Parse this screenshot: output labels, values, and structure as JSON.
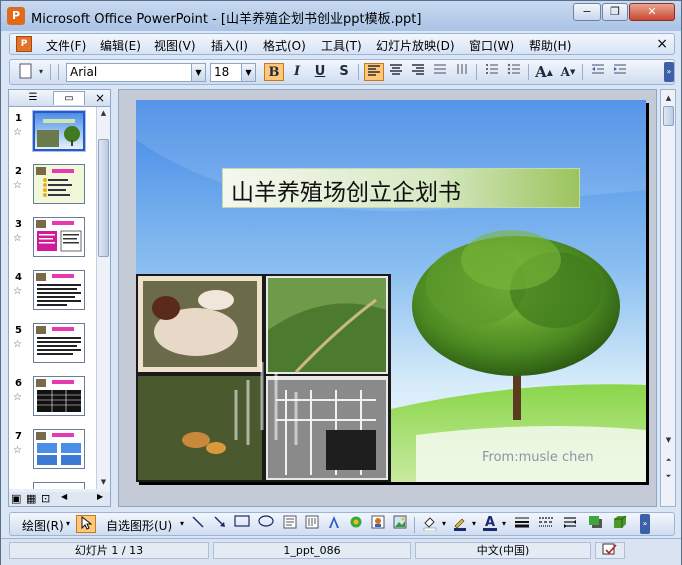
{
  "window": {
    "title": "Microsoft Office PowerPoint - [山羊养殖企划书创业ppt模板.ppt]",
    "app_icon": "powerpoint-icon",
    "minimize_label": "−",
    "restore_label": "❐",
    "close_label": "✕"
  },
  "menubar": {
    "items": [
      "文件(F)",
      "编辑(E)",
      "视图(V)",
      "插入(I)",
      "格式(O)",
      "工具(T)",
      "幻灯片放映(D)",
      "窗口(W)",
      "帮助(H)"
    ],
    "close_label": "×"
  },
  "toolbar": {
    "font_name": "Arial",
    "font_size": "18",
    "bold_label": "B",
    "italic_label": "I",
    "underline_label": "U",
    "shadow_label": "S",
    "grow_label": "A",
    "shrink_label": "A",
    "active": "align-left",
    "icons": [
      "new-slide-icon",
      "align-left-icon",
      "align-center-icon",
      "align-right-icon",
      "distribute-icon",
      "columns-icon",
      "numbering-icon",
      "bullets-icon",
      "increase-font-icon",
      "decrease-font-icon",
      "decrease-indent-icon",
      "increase-indent-icon"
    ]
  },
  "leftpanel": {
    "tab_outline": "outline-tab-icon",
    "tab_slides": "slides-tab-icon",
    "close_label": "×",
    "slides": [
      {
        "num": "1",
        "selected": true
      },
      {
        "num": "2",
        "selected": false
      },
      {
        "num": "3",
        "selected": false
      },
      {
        "num": "4",
        "selected": false
      },
      {
        "num": "5",
        "selected": false
      },
      {
        "num": "6",
        "selected": false
      },
      {
        "num": "7",
        "selected": false
      }
    ],
    "star_label": "☆"
  },
  "slide": {
    "title": "山羊养殖场创立企划书",
    "from": "From:musle chen",
    "colors": {
      "sky_top": "#4a8ee8",
      "sky_bottom": "#e6f2fb",
      "grass": "#7cc43a",
      "title_green": "#9bc45c"
    }
  },
  "drawbar": {
    "draw_label": "绘图(R)",
    "autoshape_label": "自选图形(U)",
    "icons": [
      "select-arrow-icon",
      "line-icon",
      "arrow-icon",
      "rectangle-icon",
      "oval-icon",
      "textbox-icon",
      "vertical-textbox-icon",
      "wordart-icon",
      "diagram-icon",
      "clipart-icon",
      "picture-icon",
      "fill-color-icon",
      "line-color-icon",
      "font-color-icon",
      "line-style-icon",
      "dash-style-icon",
      "arrow-style-icon",
      "shadow-icon",
      "3d-icon"
    ],
    "font_color_letter": "A"
  },
  "statusbar": {
    "slide_info": "幻灯片 1 / 13",
    "design": "1_ppt_086",
    "language": "中文(中国)"
  }
}
